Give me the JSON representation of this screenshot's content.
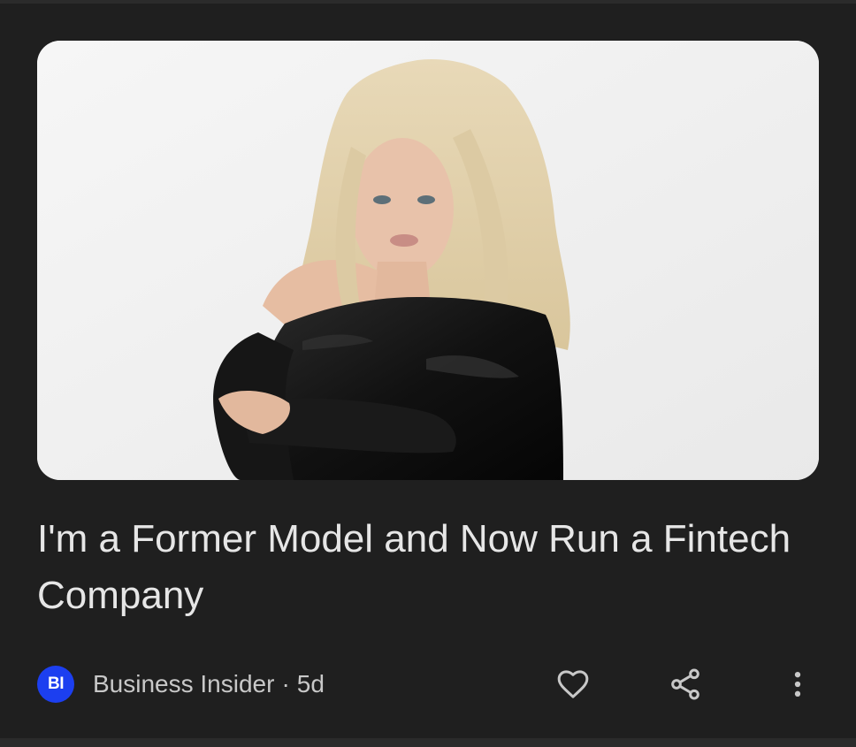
{
  "article": {
    "headline": "I'm a Former Model and Now Run a Fintech Company",
    "image_alt": "Blonde woman in a black leather off-shoulder dress with arms crossed"
  },
  "source": {
    "logo_text": "BI",
    "name": "Business Insider",
    "separator": "·",
    "age": "5d"
  },
  "actions": {
    "like_icon": "heart-outline-icon",
    "share_icon": "share-icon",
    "more_icon": "more-vert-icon"
  },
  "colors": {
    "background": "#1f1f1f",
    "text_primary": "#e6e6e6",
    "text_secondary": "#c8c8c8",
    "brand_blue": "#1c3ff0"
  }
}
